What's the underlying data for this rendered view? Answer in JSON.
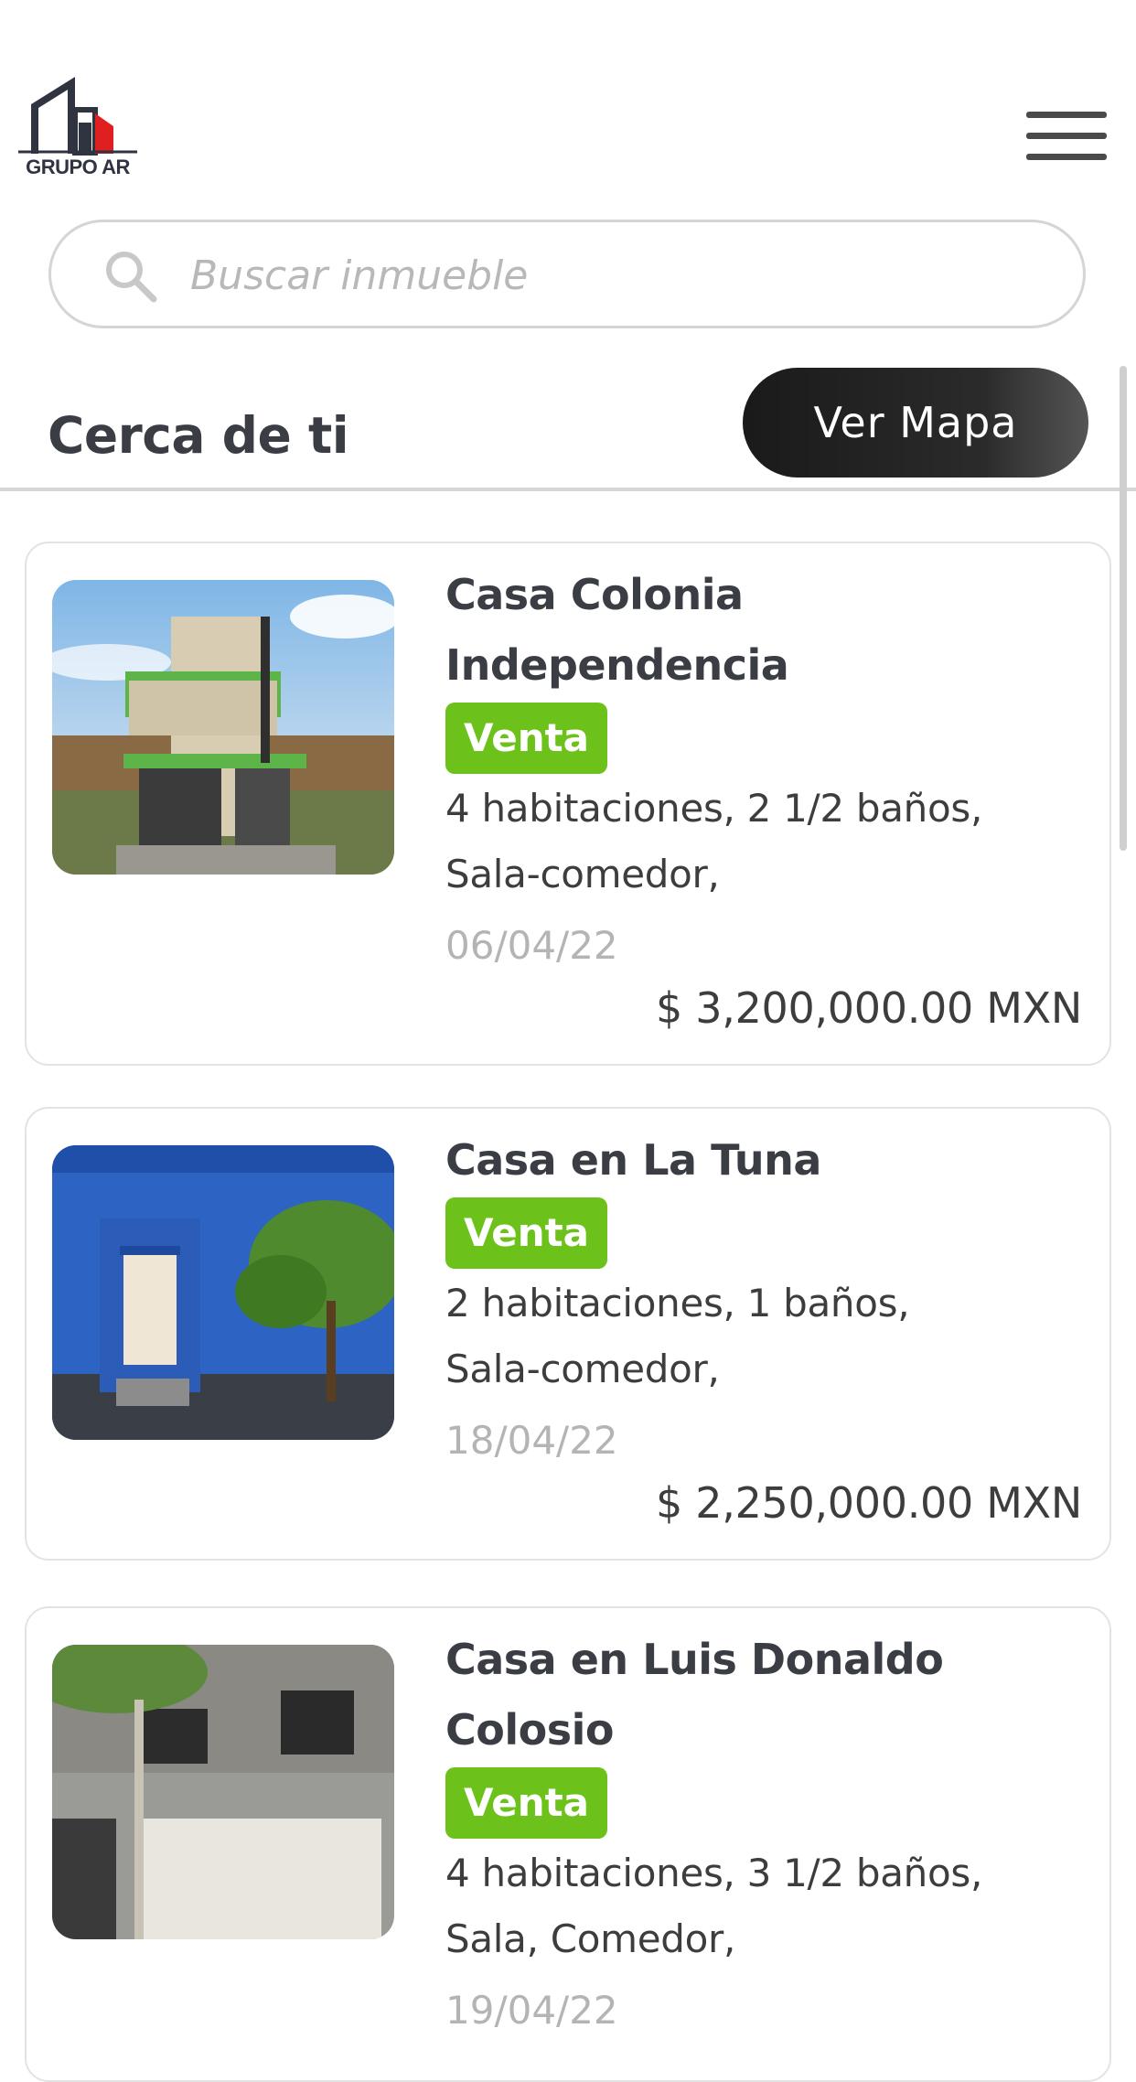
{
  "header": {
    "logo_text": "GRUPO AR",
    "menu_icon": "hamburger-menu-icon"
  },
  "search": {
    "placeholder": "Buscar inmueble",
    "icon": "search-icon"
  },
  "section": {
    "title": "Cerca de ti",
    "map_button_label": "Ver Mapa"
  },
  "listings": [
    {
      "title": "Casa Colonia Independencia",
      "badge": "Venta",
      "features_line1": "4 habitaciones, 2 1/2 baños,",
      "features_line2": " Sala-comedor,",
      "date": "06/04/22",
      "price": "$ 3,200,000.00 MXN"
    },
    {
      "title": "Casa en La Tuna",
      "badge": "Venta",
      "features_line1": "2 habitaciones, 1 baños,",
      "features_line2": " Sala-comedor,",
      "date": "18/04/22",
      "price": "$ 2,250,000.00 MXN"
    },
    {
      "title": "Casa en Luis Donaldo Colosio",
      "badge": "Venta",
      "features_line1": "4 habitaciones, 3 1/2 baños,",
      "features_line2": " Sala, Comedor,",
      "date": "19/04/22",
      "price": ""
    }
  ],
  "colors": {
    "badge_green": "#6cc21a",
    "map_button_dark": "#1a1a1a",
    "logo_red": "#e02020"
  }
}
